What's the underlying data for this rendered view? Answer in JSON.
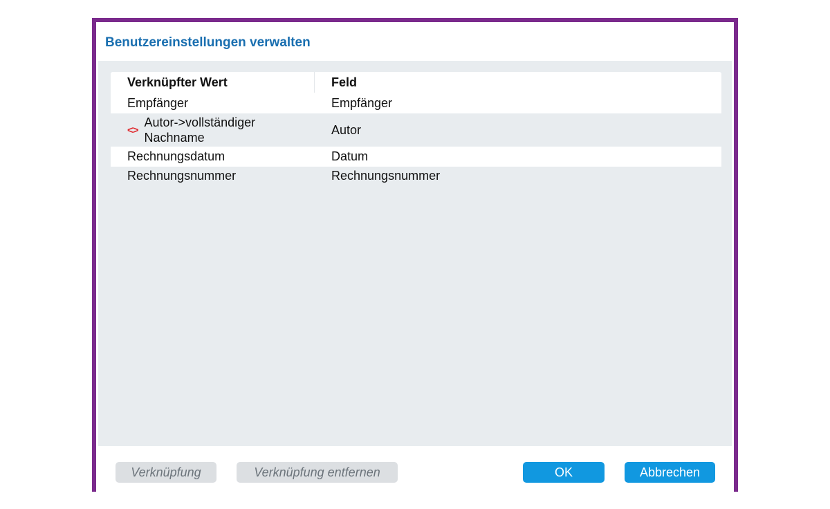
{
  "dialog": {
    "title": "Benutzereinstellungen verwalten"
  },
  "table": {
    "columns": [
      "Verknüpfter Wert",
      "Feld"
    ],
    "rows": [
      {
        "linked_value": "Empfänger",
        "field": "Empfänger",
        "linked": false
      },
      {
        "linked_value": "Autor->vollständiger Nachname",
        "linked_value_line1": "Autor->vollständiger",
        "linked_value_line2": "Nachname",
        "field": "Autor",
        "linked": true,
        "icon": "link-code-icon",
        "icon_glyph": "<>"
      },
      {
        "linked_value": "Rechnungsdatum",
        "field": "Datum",
        "linked": false
      },
      {
        "linked_value": "Rechnungsnummer",
        "field": "Rechnungsnummer",
        "linked": false
      }
    ]
  },
  "footer": {
    "link_label": "Verknüpfung",
    "unlink_label": "Verknüpfung entfernen",
    "ok_label": "OK",
    "cancel_label": "Abbrechen"
  },
  "colors": {
    "border": "#7a2a8c",
    "title": "#1a6fb0",
    "primary_button": "#1198e0",
    "disabled_button": "#dcdfe2",
    "link_icon": "#e0262b"
  }
}
